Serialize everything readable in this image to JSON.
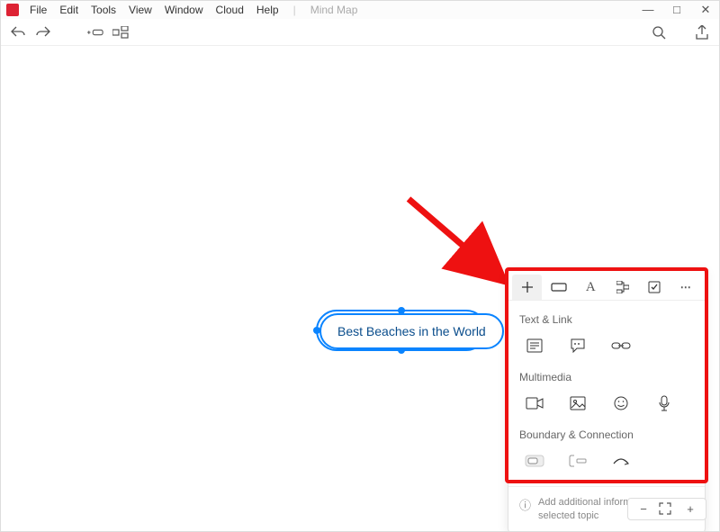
{
  "app": {
    "logo_char": ""
  },
  "menubar": {
    "items": [
      "File",
      "Edit",
      "Tools",
      "View",
      "Window",
      "Cloud",
      "Help"
    ],
    "document": "Mind Map"
  },
  "window_controls": {
    "minimize": "—",
    "maximize": "□",
    "close": "✕"
  },
  "toolbar": {
    "undo": "",
    "redo": "",
    "add_node": "",
    "layout": "",
    "search": "",
    "share": ""
  },
  "node": {
    "text": "Best Beaches in the World"
  },
  "panel": {
    "tabs": {
      "add": "",
      "shape": "",
      "text": "",
      "structure": "",
      "task": "",
      "more": ""
    },
    "sections": {
      "text_link": "Text & Link",
      "multimedia": "Multimedia",
      "boundary": "Boundary & Connection"
    },
    "hint": "Add additional information to the selected topic"
  },
  "zoom": {
    "out": "−",
    "fit": "",
    "in": "+"
  }
}
